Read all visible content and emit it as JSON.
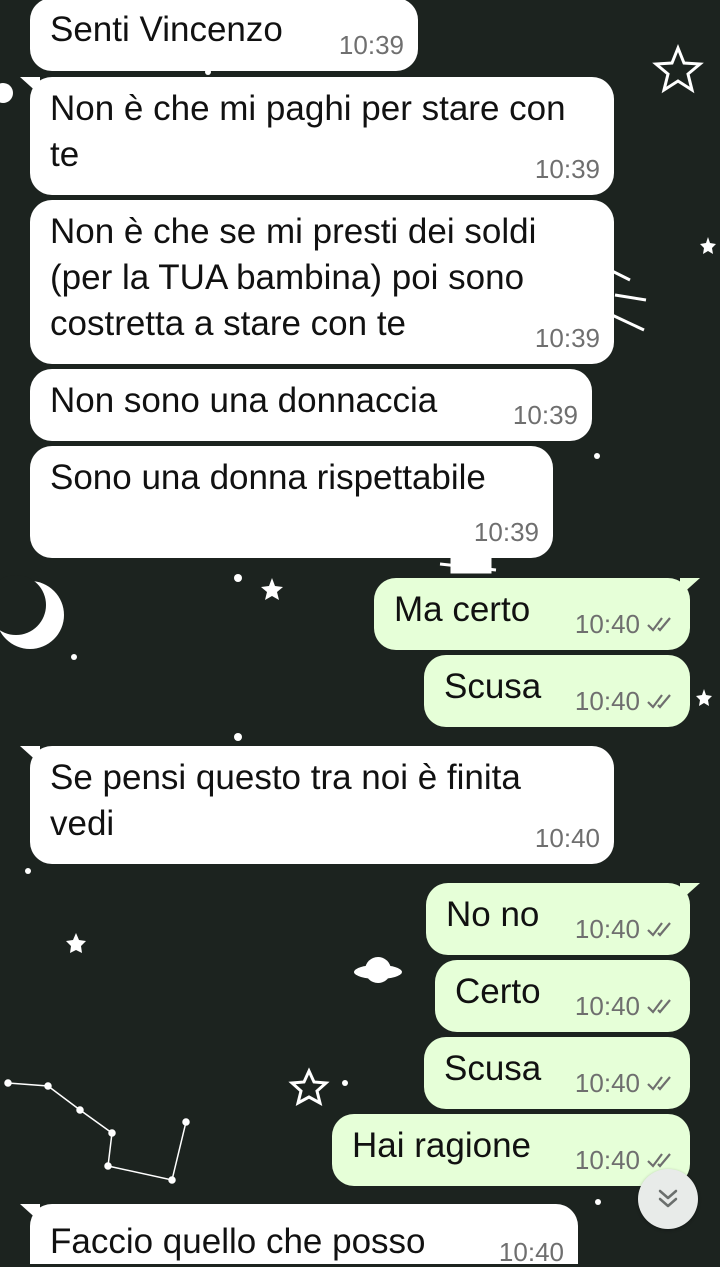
{
  "messages": [
    {
      "dir": "in",
      "text": "Senti Vincenzo",
      "time": "10:39"
    },
    {
      "dir": "in",
      "text": "Non è che mi paghi per stare con te",
      "time": "10:39"
    },
    {
      "dir": "in",
      "text": "Non è che se mi presti dei soldi (per la TUA bambina) poi sono costretta a stare con te",
      "time": "10:39"
    },
    {
      "dir": "in",
      "text": "Non sono una donnaccia",
      "time": "10:39"
    },
    {
      "dir": "in",
      "text": "Sono una donna rispettabile",
      "time": "10:39"
    },
    {
      "dir": "out",
      "text": "Ma certo",
      "time": "10:40",
      "status": "read"
    },
    {
      "dir": "out",
      "text": "Scusa",
      "time": "10:40",
      "status": "read"
    },
    {
      "dir": "in",
      "text": "Se pensi questo tra noi è finita vedi",
      "time": "10:40"
    },
    {
      "dir": "out",
      "text": "No no",
      "time": "10:40",
      "status": "read"
    },
    {
      "dir": "out",
      "text": "Certo",
      "time": "10:40",
      "status": "read"
    },
    {
      "dir": "out",
      "text": "Scusa",
      "time": "10:40",
      "status": "read"
    },
    {
      "dir": "out",
      "text": "Hai ragione",
      "time": "10:40",
      "status": "read"
    },
    {
      "dir": "in",
      "text": "Faccio quello che posso",
      "time": "10:40"
    }
  ],
  "scroll_button": {
    "icon": "double-chevron-down-icon"
  },
  "colors": {
    "wallpaper": "#1c231f",
    "incoming_bubble": "#ffffff",
    "outgoing_bubble": "#e6ffd8",
    "timestamp": "#6f6f6f",
    "read_ticks": "#6f6f6f"
  }
}
